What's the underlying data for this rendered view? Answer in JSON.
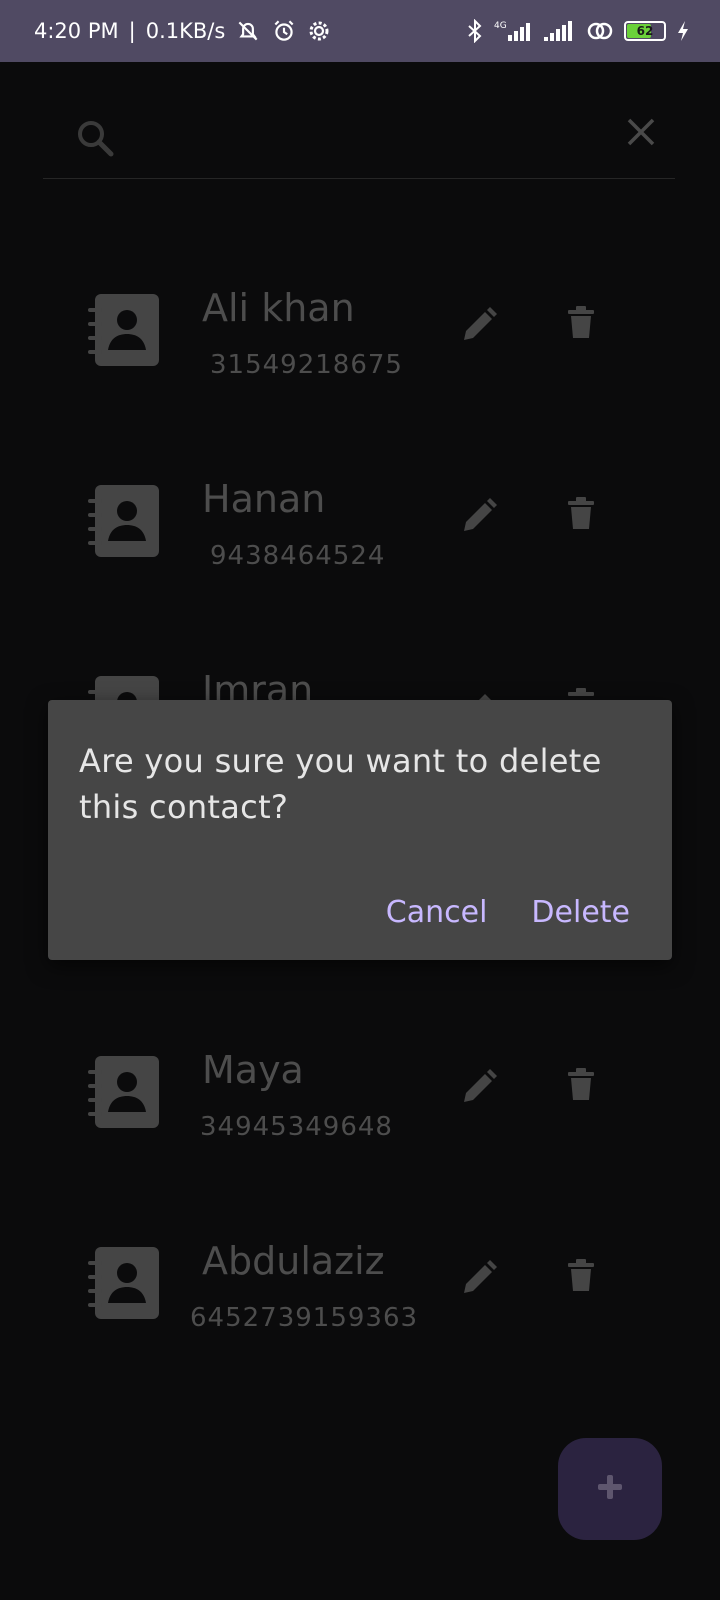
{
  "status_bar": {
    "time": "4:20 PM",
    "separator": "|",
    "speed": "0.1KB/s",
    "battery": "62",
    "icons": [
      "mute-notifications-icon",
      "alarm-icon",
      "settings-icon",
      "bluetooth-icon",
      "signal-4g-icon",
      "signal-icon",
      "hotspot-icon",
      "battery-icon",
      "charging-icon"
    ],
    "battery_color": "#6bd13a"
  },
  "search": {
    "placeholder": "",
    "icons": [
      "search-icon",
      "close-icon"
    ]
  },
  "contacts": [
    {
      "name": "Ali khan",
      "phone": "31549218675"
    },
    {
      "name": "Hanan",
      "phone": "9438464524"
    },
    {
      "name": "Imran",
      "phone": ""
    },
    {
      "name": "Maya",
      "phone": "34945349648"
    },
    {
      "name": "Abdulaziz",
      "phone": "6452739159363"
    }
  ],
  "dialog": {
    "message": "Are you sure you want to delete this contact?",
    "cancel_label": "Cancel",
    "delete_label": "Delete",
    "accent": "#c8b8ff"
  },
  "fab": {
    "icon": "plus-icon",
    "color": "#2b2340"
  }
}
